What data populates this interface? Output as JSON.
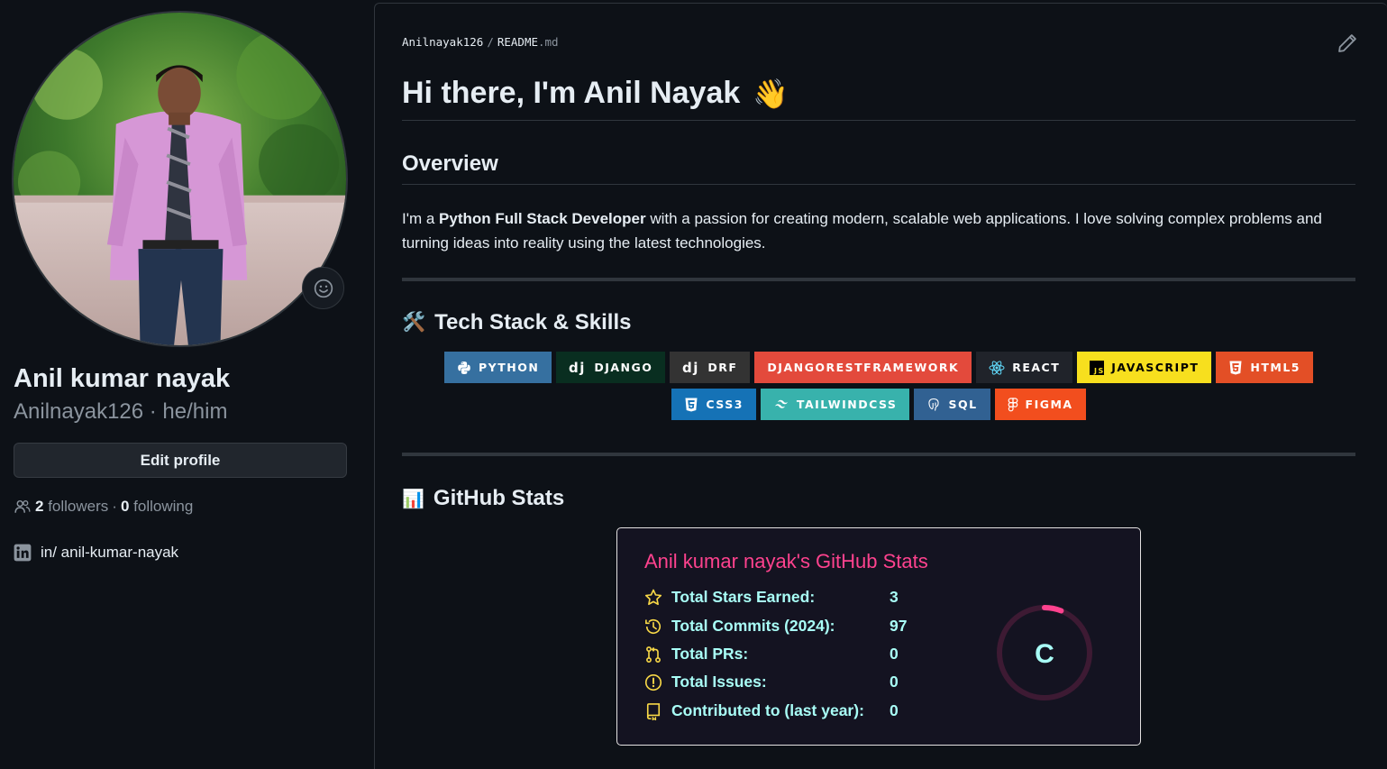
{
  "profile": {
    "display_name": "Anil kumar nayak",
    "username": "Anilnayak126",
    "pronouns": "he/him",
    "sub_line": "Anilnayak126 · he/him",
    "edit_profile_label": "Edit profile",
    "followers_count": "2",
    "followers_label": "followers",
    "separator": "·",
    "following_count": "0",
    "following_label": "following",
    "linkedin_text": "in/ anil-kumar-nayak"
  },
  "readme": {
    "breadcrumb": {
      "user": "Anilnayak126",
      "sep": "/",
      "file_name": "README",
      "file_ext": ".md"
    },
    "heading": "Hi there, I'm Anil Nayak",
    "heading_emoji": "👋",
    "overview_title": "Overview",
    "overview_pre": "I'm a ",
    "overview_bold": "Python Full Stack Developer",
    "overview_post": " with a passion for creating modern, scalable web applications. I love solving complex problems and turning ideas into reality using the latest technologies.",
    "tech_title": "Tech Stack & Skills",
    "tech_emoji": "🛠️",
    "badges_row1": [
      {
        "label": "PYTHON",
        "color": "#3670a0",
        "icon": "python-icon"
      },
      {
        "label": "DJANGO",
        "color": "#092e20",
        "icon": "django-icon"
      },
      {
        "label": "DRF",
        "color": "#333333",
        "icon": "django-icon"
      },
      {
        "label": "DJANGORESTFRAMEWORK",
        "color": "#e34a3c",
        "icon": ""
      },
      {
        "label": "REACT",
        "color": "#20232a",
        "icon": "react-icon"
      },
      {
        "label": "JAVASCRIPT",
        "color": "#f7df1e",
        "icon": "javascript-icon"
      },
      {
        "label": "HTML5",
        "color": "#e34f26",
        "icon": "html5-icon"
      }
    ],
    "badges_row2": [
      {
        "label": "CSS3",
        "color": "#1572b6",
        "icon": "css3-icon"
      },
      {
        "label": "TAILWINDCSS",
        "color": "#38b2ac",
        "icon": "tailwind-icon"
      },
      {
        "label": "SQL",
        "color": "#316192",
        "icon": "postgres-icon"
      },
      {
        "label": "FIGMA",
        "color": "#f24e1e",
        "icon": "figma-icon"
      }
    ],
    "stats_title": "GitHub Stats",
    "stats_emoji": "📊"
  },
  "stats_card": {
    "title": "Anil kumar nayak's GitHub Stats",
    "rows": [
      {
        "label": "Total Stars Earned:",
        "value": "3",
        "icon": "star-icon"
      },
      {
        "label": "Total Commits (2024):",
        "value": "97",
        "icon": "history-icon"
      },
      {
        "label": "Total PRs:",
        "value": "0",
        "icon": "pull-request-icon"
      },
      {
        "label": "Total Issues:",
        "value": "0",
        "icon": "issue-icon"
      },
      {
        "label": "Contributed to (last year):",
        "value": "0",
        "icon": "repo-icon"
      }
    ],
    "rank": "C",
    "rank_progress": 0.06,
    "title_color": "#fe428e",
    "text_color": "#a9fef7",
    "icon_color": "#f8d847"
  }
}
